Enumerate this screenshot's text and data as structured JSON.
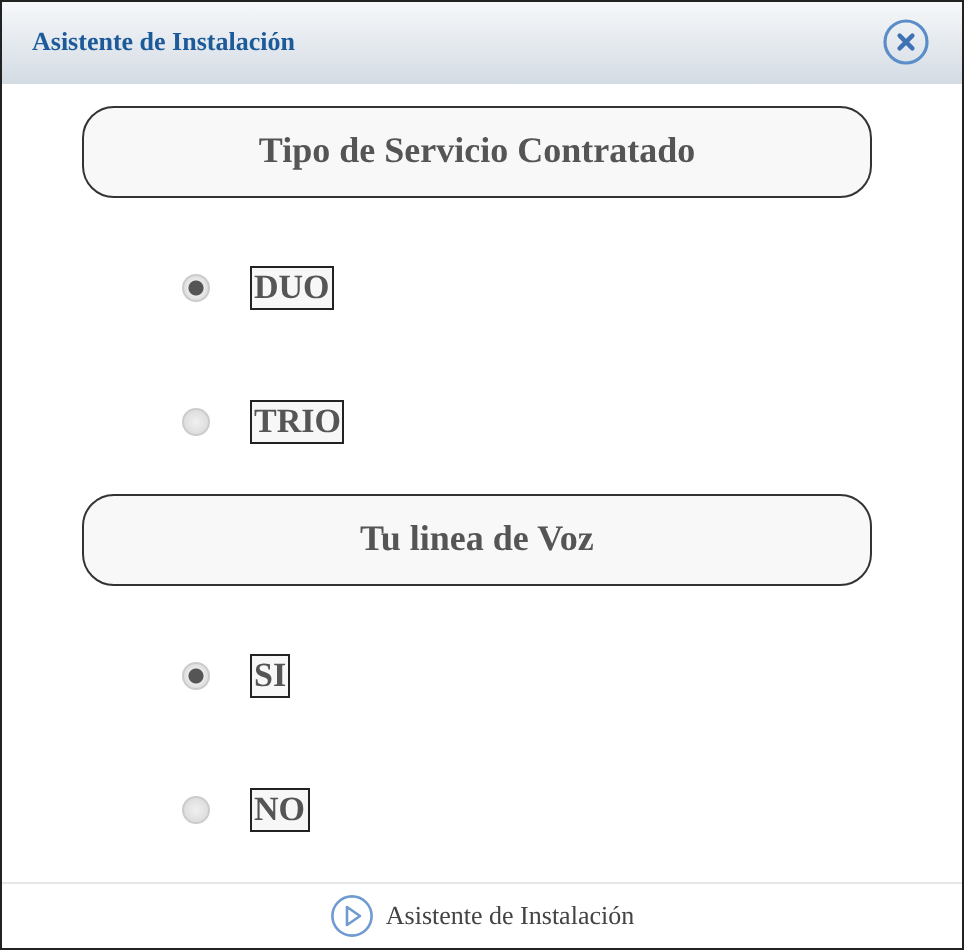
{
  "window": {
    "title": "Asistente de Instalación"
  },
  "sections": [
    {
      "heading": "Tipo de Servicio Contratado",
      "options": [
        {
          "label": "DUO",
          "selected": true
        },
        {
          "label": "TRIO",
          "selected": false
        }
      ]
    },
    {
      "heading": "Tu linea de Voz",
      "options": [
        {
          "label": "SI",
          "selected": true
        },
        {
          "label": "NO",
          "selected": false
        }
      ]
    }
  ],
  "footer": {
    "link": "Asistente de Instalación"
  }
}
